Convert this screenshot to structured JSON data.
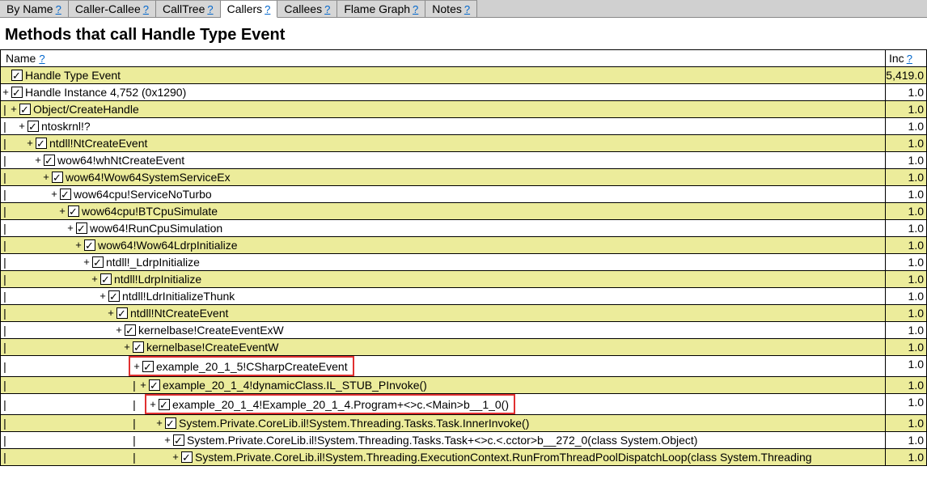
{
  "tabs": [
    {
      "label": "By Name",
      "active": false
    },
    {
      "label": "Caller-Callee",
      "active": false
    },
    {
      "label": "CallTree",
      "active": false
    },
    {
      "label": "Callers",
      "active": true
    },
    {
      "label": "Callees",
      "active": false
    },
    {
      "label": "Flame Graph",
      "active": false
    },
    {
      "label": "Notes",
      "active": false
    }
  ],
  "help_marker": "?",
  "heading": "Methods that call Handle Type Event",
  "columns": {
    "name": "Name",
    "inc": "Inc"
  },
  "rows": [
    {
      "depth": 0,
      "prefix": [],
      "exp": "",
      "label": "Handle Type Event",
      "inc": "5,419.0",
      "bg": "y",
      "hl": false
    },
    {
      "depth": 0,
      "prefix": [],
      "exp": "+",
      "label": "Handle Instance 4,752 (0x1290)",
      "inc": "1.0",
      "bg": "w",
      "hl": false
    },
    {
      "depth": 1,
      "prefix": [
        "|"
      ],
      "exp": "+",
      "label": "Object/CreateHandle",
      "inc": "1.0",
      "bg": "y",
      "hl": false
    },
    {
      "depth": 2,
      "prefix": [
        "|",
        " "
      ],
      "exp": "+",
      "label": "ntoskrnl!?",
      "inc": "1.0",
      "bg": "w",
      "hl": false
    },
    {
      "depth": 3,
      "prefix": [
        "|",
        " ",
        " "
      ],
      "exp": "+",
      "label": "ntdll!NtCreateEvent",
      "inc": "1.0",
      "bg": "y",
      "hl": false
    },
    {
      "depth": 4,
      "prefix": [
        "|",
        " ",
        " ",
        " "
      ],
      "exp": "+",
      "label": "wow64!whNtCreateEvent",
      "inc": "1.0",
      "bg": "w",
      "hl": false
    },
    {
      "depth": 5,
      "prefix": [
        "|",
        " ",
        " ",
        " ",
        " "
      ],
      "exp": "+",
      "label": "wow64!Wow64SystemServiceEx",
      "inc": "1.0",
      "bg": "y",
      "hl": false
    },
    {
      "depth": 6,
      "prefix": [
        "|",
        " ",
        " ",
        " ",
        " ",
        " "
      ],
      "exp": "+",
      "label": "wow64cpu!ServiceNoTurbo",
      "inc": "1.0",
      "bg": "w",
      "hl": false
    },
    {
      "depth": 7,
      "prefix": [
        "|",
        " ",
        " ",
        " ",
        " ",
        " ",
        " "
      ],
      "exp": "+",
      "label": "wow64cpu!BTCpuSimulate",
      "inc": "1.0",
      "bg": "y",
      "hl": false
    },
    {
      "depth": 8,
      "prefix": [
        "|",
        " ",
        " ",
        " ",
        " ",
        " ",
        " ",
        " "
      ],
      "exp": "+",
      "label": "wow64!RunCpuSimulation",
      "inc": "1.0",
      "bg": "w",
      "hl": false
    },
    {
      "depth": 9,
      "prefix": [
        "|",
        " ",
        " ",
        " ",
        " ",
        " ",
        " ",
        " ",
        " "
      ],
      "exp": "+",
      "label": "wow64!Wow64LdrpInitialize",
      "inc": "1.0",
      "bg": "y",
      "hl": false
    },
    {
      "depth": 10,
      "prefix": [
        "|",
        " ",
        " ",
        " ",
        " ",
        " ",
        " ",
        " ",
        " ",
        " "
      ],
      "exp": "+",
      "label": "ntdll!_LdrpInitialize",
      "inc": "1.0",
      "bg": "w",
      "hl": false
    },
    {
      "depth": 11,
      "prefix": [
        "|",
        " ",
        " ",
        " ",
        " ",
        " ",
        " ",
        " ",
        " ",
        " ",
        " "
      ],
      "exp": "+",
      "label": "ntdll!LdrpInitialize",
      "inc": "1.0",
      "bg": "y",
      "hl": false
    },
    {
      "depth": 12,
      "prefix": [
        "|",
        " ",
        " ",
        " ",
        " ",
        " ",
        " ",
        " ",
        " ",
        " ",
        " ",
        " "
      ],
      "exp": "+",
      "label": "ntdll!LdrInitializeThunk",
      "inc": "1.0",
      "bg": "w",
      "hl": false
    },
    {
      "depth": 13,
      "prefix": [
        "|",
        " ",
        " ",
        " ",
        " ",
        " ",
        " ",
        " ",
        " ",
        " ",
        " ",
        " ",
        " "
      ],
      "exp": "+",
      "label": "ntdll!NtCreateEvent",
      "inc": "1.0",
      "bg": "y",
      "hl": false
    },
    {
      "depth": 14,
      "prefix": [
        "|",
        " ",
        " ",
        " ",
        " ",
        " ",
        " ",
        " ",
        " ",
        " ",
        " ",
        " ",
        " ",
        " "
      ],
      "exp": "+",
      "label": "kernelbase!CreateEventExW",
      "inc": "1.0",
      "bg": "w",
      "hl": false
    },
    {
      "depth": 15,
      "prefix": [
        "|",
        " ",
        " ",
        " ",
        " ",
        " ",
        " ",
        " ",
        " ",
        " ",
        " ",
        " ",
        " ",
        " ",
        " "
      ],
      "exp": "+",
      "label": "kernelbase!CreateEventW",
      "inc": "1.0",
      "bg": "y",
      "hl": false
    },
    {
      "depth": 16,
      "prefix": [
        "|",
        " ",
        " ",
        " ",
        " ",
        " ",
        " ",
        " ",
        " ",
        " ",
        " ",
        " ",
        " ",
        " ",
        " ",
        " "
      ],
      "exp": "+",
      "label": "example_20_1_5!CSharpCreateEvent",
      "inc": "1.0",
      "bg": "w",
      "hl": true
    },
    {
      "depth": 17,
      "prefix": [
        "|",
        " ",
        " ",
        " ",
        " ",
        " ",
        " ",
        " ",
        " ",
        " ",
        " ",
        " ",
        " ",
        " ",
        " ",
        " ",
        "|"
      ],
      "exp": "+",
      "label": "example_20_1_4!dynamicClass.IL_STUB_PInvoke()",
      "inc": "1.0",
      "bg": "y",
      "hl": false
    },
    {
      "depth": 18,
      "prefix": [
        "|",
        " ",
        " ",
        " ",
        " ",
        " ",
        " ",
        " ",
        " ",
        " ",
        " ",
        " ",
        " ",
        " ",
        " ",
        " ",
        "|",
        " "
      ],
      "exp": "+",
      "label": "example_20_1_4!Example_20_1_4.Program+<>c.<Main>b__1_0()",
      "inc": "1.0",
      "bg": "w",
      "hl": true
    },
    {
      "depth": 19,
      "prefix": [
        "|",
        " ",
        " ",
        " ",
        " ",
        " ",
        " ",
        " ",
        " ",
        " ",
        " ",
        " ",
        " ",
        " ",
        " ",
        " ",
        "|",
        " ",
        " "
      ],
      "exp": "+",
      "label": "System.Private.CoreLib.il!System.Threading.Tasks.Task.InnerInvoke()",
      "inc": "1.0",
      "bg": "y",
      "hl": false
    },
    {
      "depth": 20,
      "prefix": [
        "|",
        " ",
        " ",
        " ",
        " ",
        " ",
        " ",
        " ",
        " ",
        " ",
        " ",
        " ",
        " ",
        " ",
        " ",
        " ",
        "|",
        " ",
        " ",
        " "
      ],
      "exp": "+",
      "label": "System.Private.CoreLib.il!System.Threading.Tasks.Task+<>c.<.cctor>b__272_0(class System.Object)",
      "inc": "1.0",
      "bg": "w",
      "hl": false
    },
    {
      "depth": 21,
      "prefix": [
        "|",
        " ",
        " ",
        " ",
        " ",
        " ",
        " ",
        " ",
        " ",
        " ",
        " ",
        " ",
        " ",
        " ",
        " ",
        " ",
        "|",
        " ",
        " ",
        " ",
        " "
      ],
      "exp": "+",
      "label": "System.Private.CoreLib.il!System.Threading.ExecutionContext.RunFromThreadPoolDispatchLoop(class System.Threading",
      "inc": "1.0",
      "bg": "y",
      "hl": false
    }
  ]
}
